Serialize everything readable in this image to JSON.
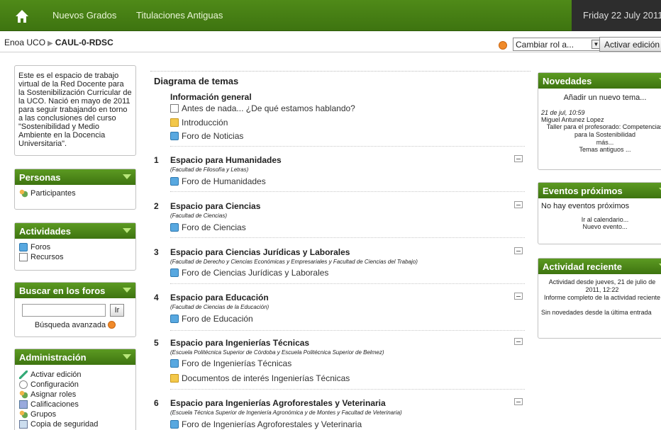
{
  "topbar": {
    "nav": [
      "Nuevos Grados",
      "Titulaciones Antiguas"
    ],
    "date": "Friday 22 July 2011"
  },
  "navbar": {
    "breadcrumb": [
      "Enoa UCO",
      "CAUL-0-RDSC"
    ],
    "role_select": "Cambiar rol a...",
    "edit_button": "Activar edición"
  },
  "intro": "Este es el espacio de trabajo virtual de la Red Docente para la Sostenibilización Curricular de la UCO. Nació en mayo de 2011 para seguir trabajando en torno a las conclusiones del curso \"Sostenibilidad y Medio Ambiente en la Docencia Universitaria\".",
  "personas": {
    "title": "Personas",
    "items": [
      "Participantes"
    ]
  },
  "actividades": {
    "title": "Actividades",
    "items": [
      "Foros",
      "Recursos"
    ]
  },
  "buscar": {
    "title": "Buscar en los foros",
    "button": "Ir",
    "advanced": "Búsqueda avanzada"
  },
  "admin": {
    "title": "Administración",
    "items": [
      "Activar edición",
      "Configuración",
      "Asignar roles",
      "Calificaciones",
      "Grupos",
      "Copia de seguridad"
    ]
  },
  "main": {
    "title": "Diagrama de temas",
    "general": {
      "title": "Información general",
      "items": [
        "Antes de nada... ¿De qué estamos hablando?",
        "Introducción",
        "Foro de Noticias"
      ]
    },
    "sections": [
      {
        "num": "1",
        "title": "Espacio para Humanidades",
        "sub": "(Facultad de Filosofía y Letras)",
        "links": [
          "Foro de Humanidades"
        ]
      },
      {
        "num": "2",
        "title": "Espacio para Ciencias",
        "sub": "(Facultad de Ciencias)",
        "links": [
          "Foro de Ciencias"
        ]
      },
      {
        "num": "3",
        "title": "Espacio para Ciencias Jurídicas y Laborales",
        "sub": "(Facultad de Derecho y Ciencias Económicas y Empresariales y Facultad de Ciencias del Trabajo)",
        "links": [
          "Foro de Ciencias Jurídicas y Laborales"
        ]
      },
      {
        "num": "4",
        "title": "Espacio para Educación",
        "sub": "(Facultad de Ciencias de la Educación)",
        "links": [
          "Foro de Educación"
        ]
      },
      {
        "num": "5",
        "title": "Espacio para Ingenierías Técnicas",
        "sub": "(Escuela Politécnica Superior de Córdoba y Escuela Politécnica Superior de Belmez)",
        "links": [
          "Foro de Ingenierías Técnicas",
          "Documentos de interés Ingenierías Técnicas"
        ]
      },
      {
        "num": "6",
        "title": "Espacio para Ingenierías Agroforestales y Veterinaria",
        "sub": "(Escuela Técnica Superior de Ingeniería Agronómica y de Montes y Facultad de Veterinaria)",
        "links": [
          "Foro de Ingenierías Agroforestales y Veterinaria"
        ]
      }
    ]
  },
  "novedades": {
    "title": "Novedades",
    "add": "Añadir un nuevo tema...",
    "date": "21 de jul, 10:59",
    "author": "Miguel Antunez Lopez",
    "post": "Taller para el profesorado: Competencias para la Sostenibilidad",
    "more": "más...",
    "older": "Temas antiguos ..."
  },
  "eventos": {
    "title": "Eventos próximos",
    "none": "No hay eventos próximos",
    "calendar": "Ir al calendario...",
    "new": "Nuevo evento..."
  },
  "reciente": {
    "title": "Actividad reciente",
    "since": "Actividad desde jueves, 21 de julio de 2011, 12:22",
    "report": "Informe completo de la actividad reciente",
    "none": "Sin novedades desde la última entrada"
  }
}
